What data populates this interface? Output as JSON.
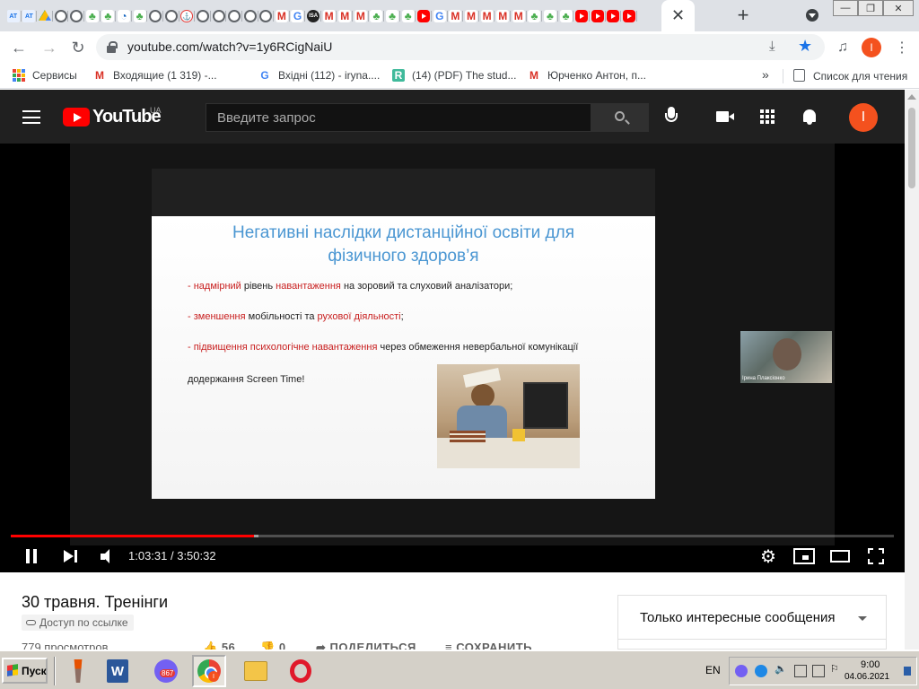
{
  "browser": {
    "tab_favicons": [
      "at",
      "at",
      "drive",
      "globe",
      "globe",
      "tree",
      "tree",
      "wave",
      "tree",
      "globe",
      "globe",
      "anchor",
      "globe",
      "globe",
      "globe",
      "globe",
      "globe",
      "gmail",
      "google",
      "dark",
      "gmail",
      "gmail",
      "gmail",
      "tree",
      "tree",
      "tree",
      "yt",
      "google",
      "gmail",
      "gmail",
      "gmail",
      "gmail",
      "gmail",
      "tree",
      "tree",
      "tree",
      "yt",
      "yt",
      "yt",
      "yt"
    ],
    "tab_letters": {
      "at": "AT",
      "gmail": "M",
      "google": "G",
      "dark": "ISA"
    },
    "active_tab_close": "✕",
    "new_tab": "+",
    "url": "youtube.com/watch?v=1y6RCigNaiU",
    "profile_initial": "I",
    "win_controls": [
      "—",
      "❐",
      "✕"
    ]
  },
  "bookmarks": {
    "items": [
      {
        "icon": "apps-icon",
        "label": "Сервисы"
      },
      {
        "icon": "gmail-icon",
        "label": "Входящие (1 319) -..."
      },
      {
        "icon": "gmail-icon",
        "label": "Вхідні (112) - iryna...."
      },
      {
        "icon": "researchgate-icon",
        "label": "(14) (PDF) The stud..."
      },
      {
        "icon": "gmail-icon",
        "label": "Юрченко Антон, п..."
      }
    ],
    "more": "»",
    "reading_list": "Список для чтения"
  },
  "youtube": {
    "wordmark": "YouTube",
    "country": "UA",
    "search_placeholder": "Введите запрос",
    "avatar_initial": "I"
  },
  "slide": {
    "title_line1": "Негативні наслідки дистанційної освіти для",
    "title_line2": "фізичного здоров’я",
    "bullets": [
      [
        {
          "t": "- надмірний",
          "red": true
        },
        {
          "t": "  рівень ",
          "red": false
        },
        {
          "t": "навантаження",
          "red": true
        },
        {
          "t": " на зоровий та слуховий аналізатори;",
          "red": false
        }
      ],
      [
        {
          "t": "- зменшення",
          "red": true
        },
        {
          "t": " мобільності та ",
          "red": false
        },
        {
          "t": "рухової діяльності",
          "red": true
        },
        {
          "t": ";",
          "red": false
        }
      ],
      [
        {
          "t": "- підвищення психологічне навантаження",
          "red": true
        },
        {
          "t": " через обмеження невербальної комунікації",
          "red": false
        }
      ],
      [
        {
          "t": "додержання Screen Time!",
          "red": false
        }
      ]
    ],
    "webcam_name": "Ірина Плаксіонко"
  },
  "player": {
    "current_time": "1:03:31",
    "duration": "3:50:32",
    "time_display": "1:03:31 / 3:50:32",
    "played_fraction": 0.2755,
    "buffered_fraction": 0.2806
  },
  "video": {
    "title": "30 травня. Тренінги",
    "access": "Доступ по ссылке",
    "views": "779 просмотров",
    "likes": "56",
    "dislikes": "0",
    "share": "ПОДЕЛИТЬСЯ",
    "save": "СОХРАНИТЬ"
  },
  "chat": {
    "filter": "Только интересные сообщения"
  },
  "taskbar": {
    "start": "Пуск",
    "viber_badge": "867",
    "chrome_badge": "I",
    "language": "EN",
    "time": "9:00",
    "date": "04.06.2021"
  }
}
